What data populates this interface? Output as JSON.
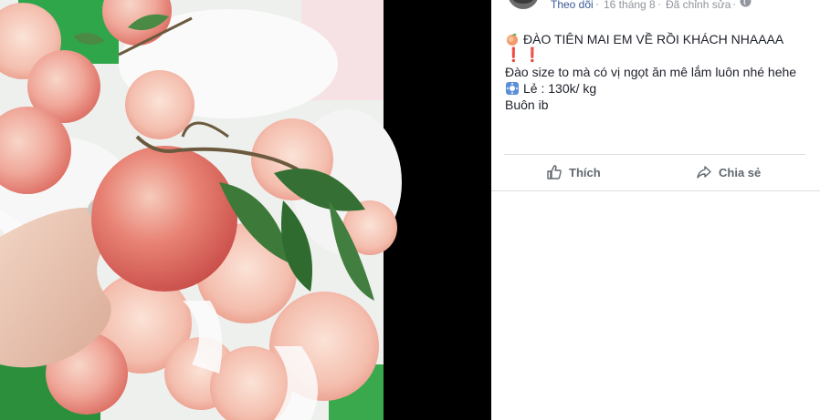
{
  "post": {
    "follow_label": "Theo dõi",
    "separator": "·",
    "date": "16 tháng 8",
    "edited_label": "Đã chỉnh sửa",
    "line1": "ĐÀO TIÊN MAI EM VỀ RỒI KHÁCH NHAAAA",
    "line2_exclaims": "❗❗",
    "line3": "Đào size to mà có vị ngọt ăn mê lắm luôn nhé hehe",
    "line4": "Lẻ : 130k/ kg",
    "line5": "Buôn ib"
  },
  "actions": {
    "like_label": "Thích",
    "share_label": "Chia sẻ"
  },
  "colors": {
    "link": "#385898",
    "meta": "#90949c",
    "text": "#1d2129",
    "action": "#606770"
  }
}
